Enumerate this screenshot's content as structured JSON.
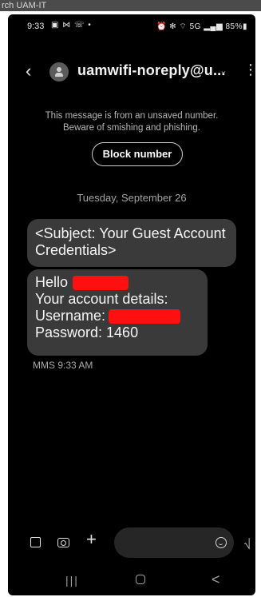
{
  "window": {
    "background_title": "rch UAM-IT"
  },
  "status_bar": {
    "time": "9:33",
    "notification_icons": "▣ ⋈ ☏ •",
    "system_icons": "⏰ ✻ ⌔ 5G ▂▄▆ 85%▮"
  },
  "header": {
    "back_icon": "chevron-left-icon",
    "contact_name": "uamwifi-noreply@u...",
    "expand_icon": "chevron-down-icon",
    "menu_icon": "more-vert-icon"
  },
  "notice": {
    "line1": "This message is from an unsaved number.",
    "line2": "Beware of smishing and phishing."
  },
  "block_button": {
    "label": "Block number"
  },
  "date_separator": "Tuesday, September 26",
  "messages": {
    "subject": "<Subject: Your Guest Account Credentials>",
    "greeting": "Hello",
    "details_line": "Your account details:",
    "username_label": "Username:",
    "password_line": "Password: 1460",
    "meta": "MMS 9:33 AM"
  },
  "input_bar": {
    "placeholder": "",
    "gallery_icon": "image-icon",
    "camera_icon": "camera-icon",
    "plus_icon": "plus-icon",
    "emoji_icon": "emoji-icon",
    "voice_icon": "voice-icon"
  },
  "nav_bar": {
    "recents_glyph": "|||",
    "back_glyph": "<"
  },
  "colors": {
    "screen_bg": "#000000",
    "bubble_bg": "#3a3a3a",
    "redaction": "#ff1010",
    "muted_text": "#a4a4a4"
  }
}
